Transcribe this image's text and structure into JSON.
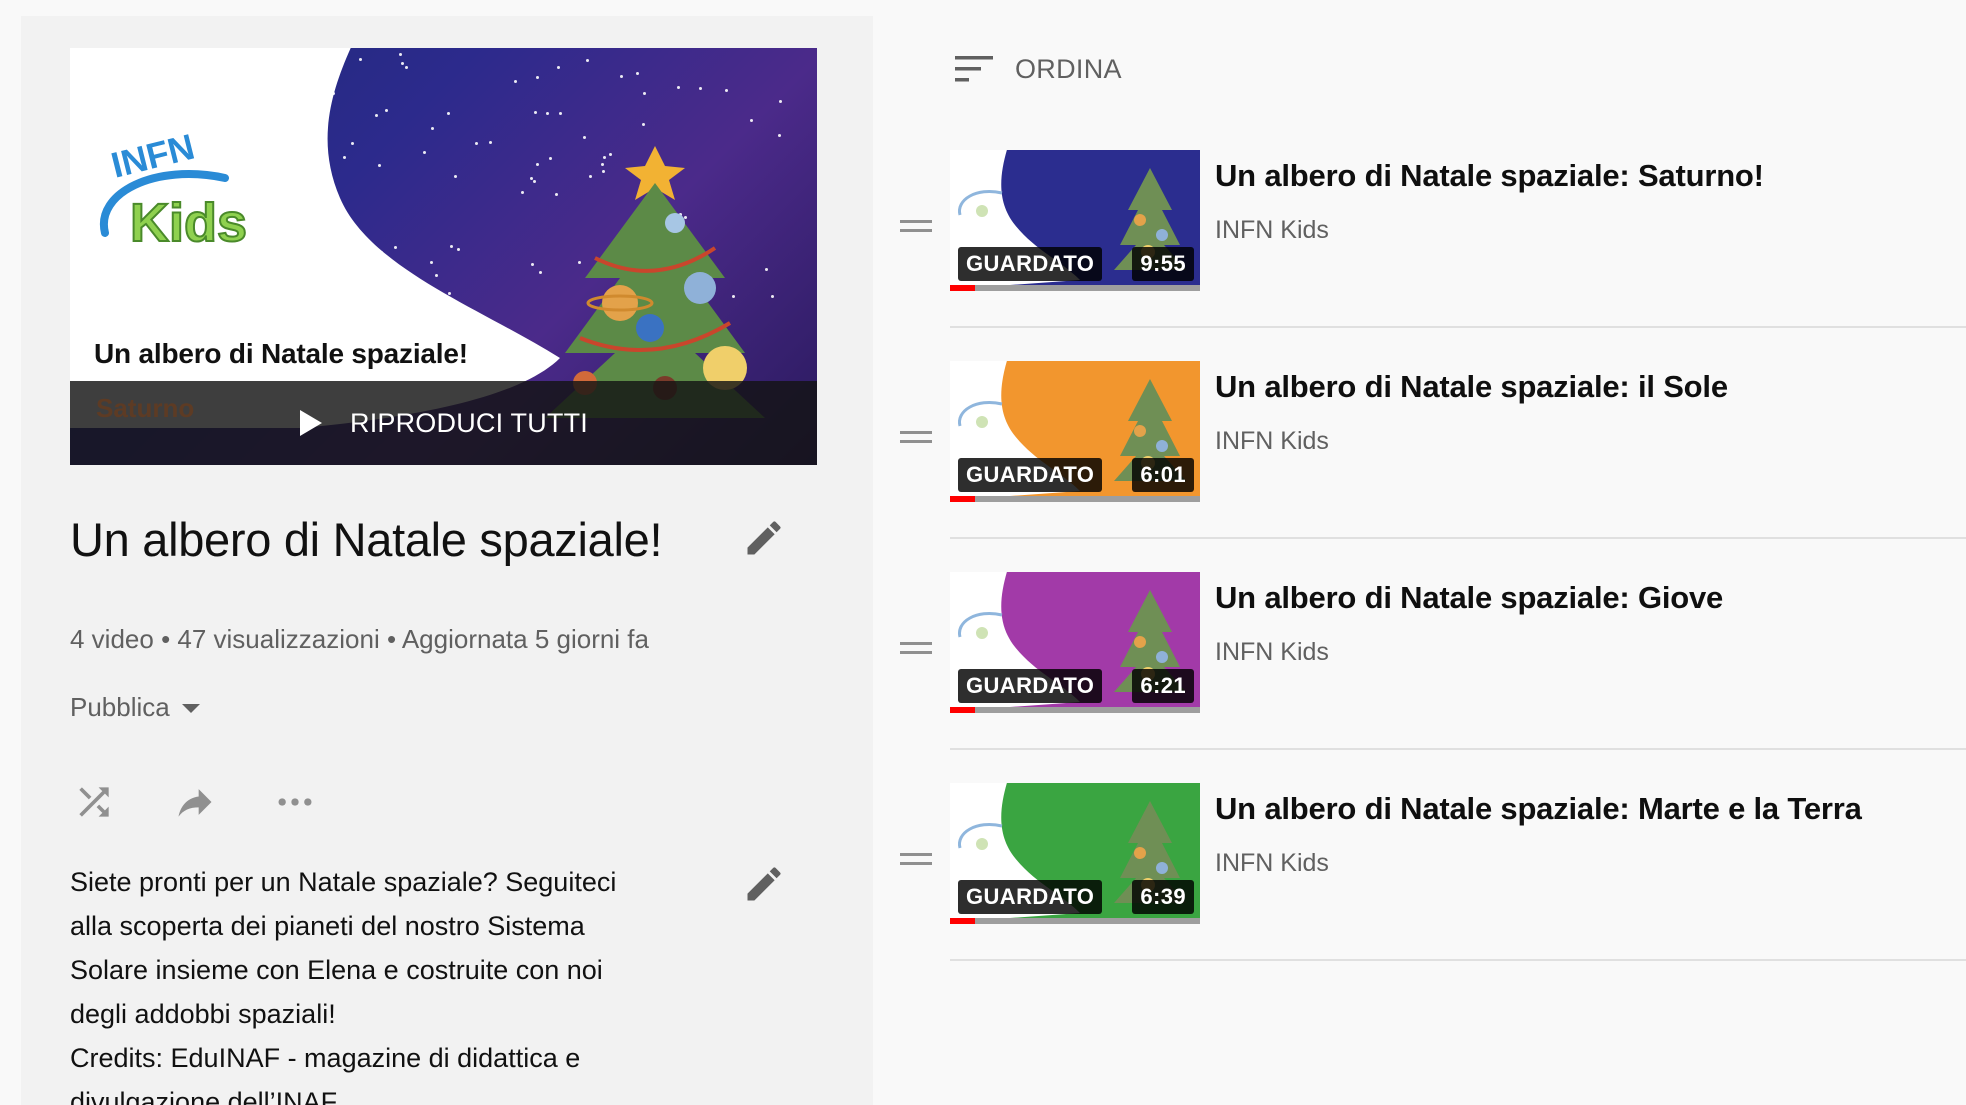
{
  "hero": {
    "logo_text_top": "INFN",
    "logo_text_bottom": "Kids",
    "subtitle": "Un albero di Natale spaziale!",
    "faded_caption": "Saturno",
    "play_all_label": "RIPRODUCI TUTTI"
  },
  "playlist": {
    "title": "Un albero di Natale spaziale!",
    "meta": "4 video • 47 visualizzazioni • Aggiornata 5 giorni fa",
    "privacy": "Pubblica",
    "description_lines": [
      "Siete pronti per un Natale spaziale? Seguiteci",
      "alla scoperta dei pianeti del nostro Sistema",
      "Solare insieme con Elena e costruite con noi",
      "degli addobbi spaziali!",
      "Credits: EduINAF - magazine di didattica e",
      "divulgazione dell’INAF"
    ]
  },
  "sort": {
    "label": "ORDINA"
  },
  "videos": [
    {
      "title": "Un albero di Natale spaziale: Saturno!",
      "channel": "INFN Kids",
      "watched_label": "GUARDATO",
      "duration": "9:55",
      "thumb_color": "#2b2d8f",
      "progress": 0.1
    },
    {
      "title": "Un albero di Natale spaziale: il Sole",
      "channel": "INFN Kids",
      "watched_label": "GUARDATO",
      "duration": "6:01",
      "thumb_color": "#f2962e",
      "progress": 0.1
    },
    {
      "title": "Un albero di Natale spaziale: Giove",
      "channel": "INFN Kids",
      "watched_label": "GUARDATO",
      "duration": "6:21",
      "thumb_color": "#a23aa8",
      "progress": 0.1
    },
    {
      "title": "Un albero di Natale spaziale: Marte e la Terra",
      "channel": "INFN Kids",
      "watched_label": "GUARDATO",
      "duration": "6:39",
      "thumb_color": "#3aa541",
      "progress": 0.1
    }
  ],
  "colors": {
    "accent_red": "#ff0000",
    "panel_bg": "#f2f2f2",
    "page_bg": "#f9f9f9"
  }
}
